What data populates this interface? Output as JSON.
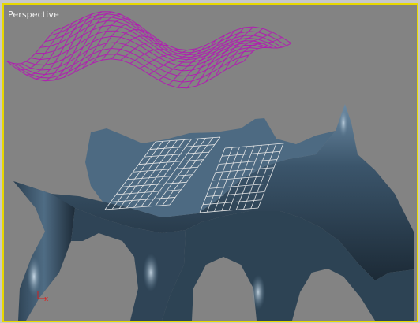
{
  "viewport": {
    "label": "Perspective",
    "active_border_color": "#e8d800",
    "background_color": "#838383"
  },
  "scene": {
    "wireframe_color": "#b020b0",
    "surface_color": "#3c5468",
    "grid_color": "#e6e6e6",
    "axis_x_label": "x"
  }
}
